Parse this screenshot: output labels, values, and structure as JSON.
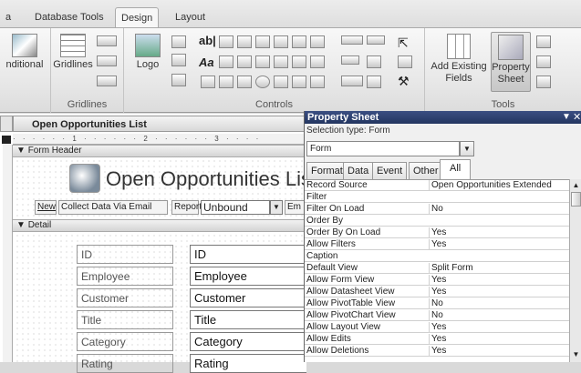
{
  "tabs": [
    "a",
    "Database Tools",
    "Design",
    "Layout"
  ],
  "ribbon": {
    "groups": {
      "conditional": "nditional",
      "gridlines_btn": "Gridlines",
      "gridlines_group": "Gridlines",
      "logo": "Logo",
      "controls_group": "Controls",
      "add_fields_1": "Add Existing",
      "add_fields_2": "Fields",
      "prop_sheet_1": "Property",
      "prop_sheet_2": "Sheet",
      "tools_group": "Tools"
    },
    "controls_text_icons": [
      "ab|",
      "Aa"
    ]
  },
  "document": {
    "tab_title": "Open Opportunities List",
    "ruler_text": "· · · · · · 1 · · · · · · 2 · · · · · · 3 · · · ·",
    "form_header_label": "Form Header",
    "form_title": "Open Opportunities List",
    "header_controls": {
      "new": "New",
      "collect": "Collect Data Via Email",
      "report_label": "Report:",
      "report_value": "Unbound",
      "email_partial": "Em"
    },
    "detail_label": "Detail",
    "fields": [
      {
        "label": "ID",
        "value": "ID"
      },
      {
        "label": "Employee",
        "value": "Employee"
      },
      {
        "label": "Customer",
        "value": "Customer"
      },
      {
        "label": "Title",
        "value": "Title"
      },
      {
        "label": "Category",
        "value": "Category"
      },
      {
        "label": "Rating",
        "value": "Rating"
      }
    ]
  },
  "property_sheet": {
    "title": "Property Sheet",
    "selection_type": "Selection type: Form",
    "selector_value": "Form",
    "tabs": [
      "Format",
      "Data",
      "Event",
      "Other",
      "All"
    ],
    "active_tab": "All",
    "rows": [
      {
        "name": "Record Source",
        "value": "Open Opportunities Extended"
      },
      {
        "name": "Filter",
        "value": ""
      },
      {
        "name": "Filter On Load",
        "value": "No"
      },
      {
        "name": "Order By",
        "value": ""
      },
      {
        "name": "Order By On Load",
        "value": "Yes"
      },
      {
        "name": "Allow Filters",
        "value": "Yes"
      },
      {
        "name": "Caption",
        "value": ""
      },
      {
        "name": "Default View",
        "value": "Split Form"
      },
      {
        "name": "Allow Form View",
        "value": "Yes"
      },
      {
        "name": "Allow Datasheet View",
        "value": "Yes"
      },
      {
        "name": "Allow PivotTable View",
        "value": "No"
      },
      {
        "name": "Allow PivotChart View",
        "value": "No"
      },
      {
        "name": "Allow Layout View",
        "value": "Yes"
      },
      {
        "name": "Allow Edits",
        "value": "Yes"
      },
      {
        "name": "Allow Deletions",
        "value": "Yes"
      }
    ]
  }
}
